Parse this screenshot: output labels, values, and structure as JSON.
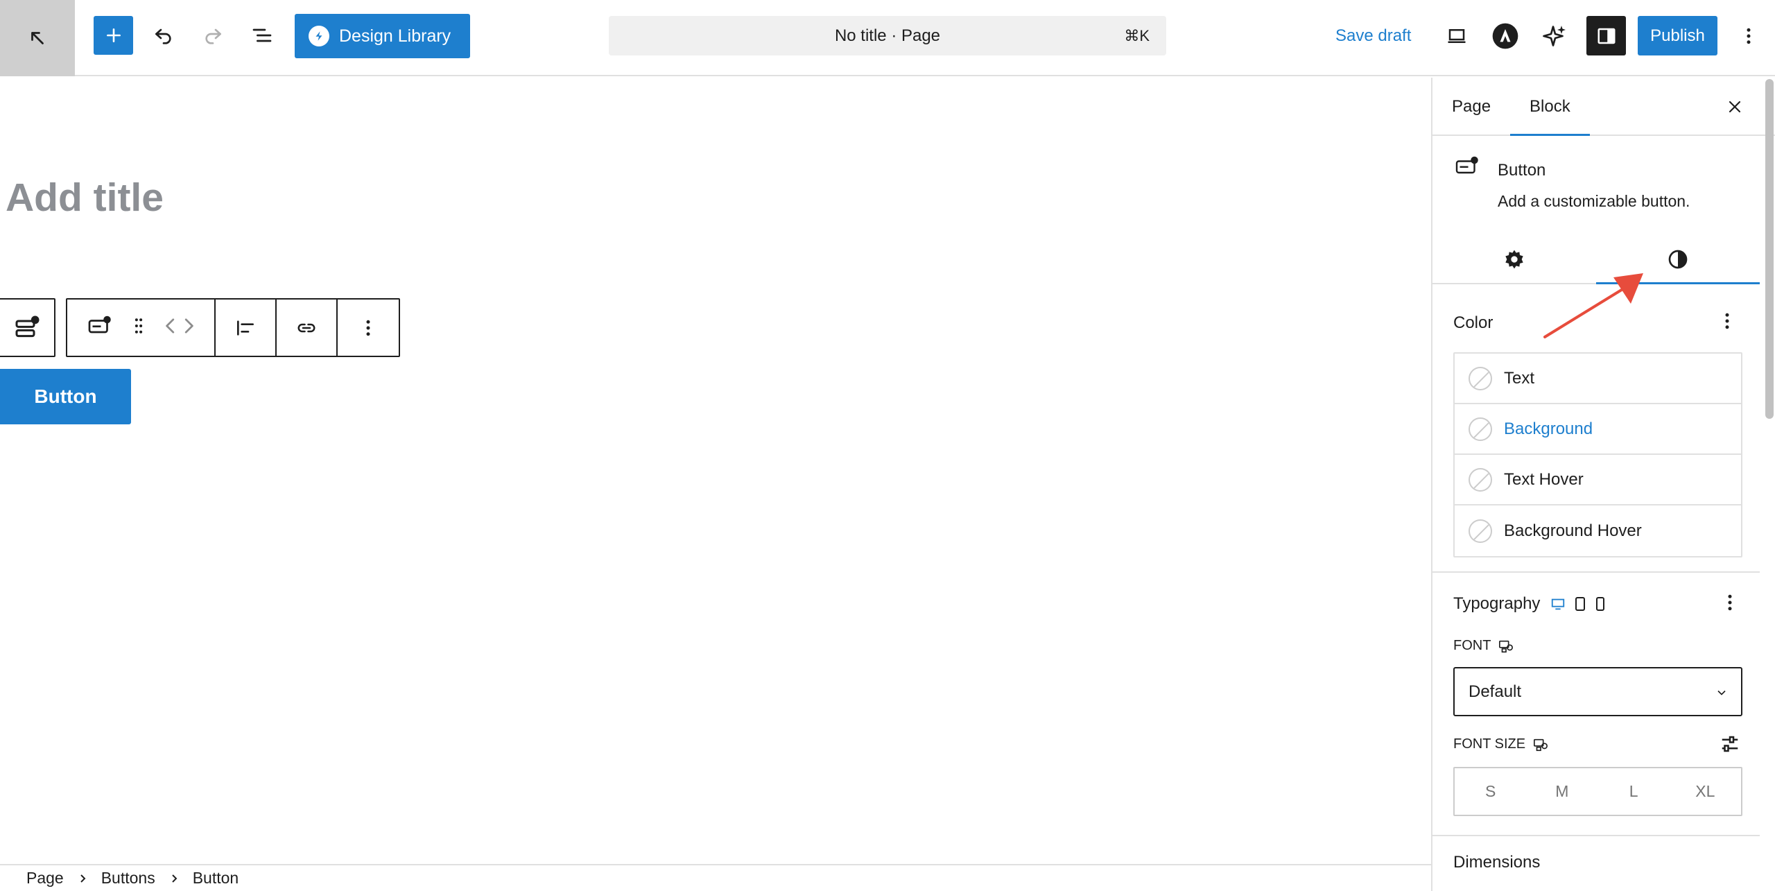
{
  "topbar": {
    "design_library_label": "Design Library",
    "document_title": "No title · Page",
    "command_shortcut": "⌘K",
    "save_draft_label": "Save draft",
    "publish_label": "Publish"
  },
  "canvas": {
    "title_placeholder": "Add title",
    "button_text": "Button"
  },
  "breadcrumb": {
    "items": [
      "Page",
      "Buttons",
      "Button"
    ]
  },
  "sidebar": {
    "tabs": [
      "Page",
      "Block"
    ],
    "active_tab": "Block",
    "block_name": "Button",
    "block_description": "Add a customizable button.",
    "color_panel": {
      "title": "Color",
      "items": [
        "Text",
        "Background",
        "Text Hover",
        "Background Hover"
      ],
      "highlighted": "Background"
    },
    "typography_panel": {
      "title": "Typography",
      "font_label": "FONT",
      "font_value": "Default",
      "font_size_label": "FONT SIZE",
      "size_options": [
        "S",
        "M",
        "L",
        "XL"
      ]
    },
    "dimensions_title": "Dimensions"
  },
  "colors": {
    "accent": "#1e7fce",
    "arrow": "#e74c3c",
    "dark": "#1e1e1e"
  }
}
